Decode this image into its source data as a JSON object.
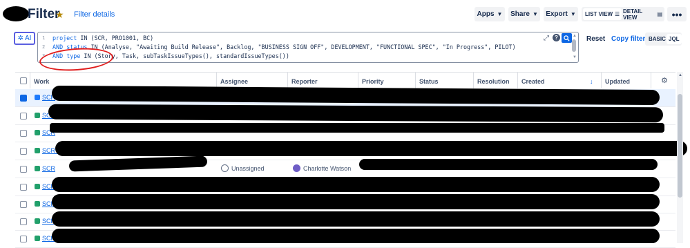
{
  "header": {
    "title": "Filter",
    "details_link": "Filter details",
    "apps_label": "Apps",
    "share_label": "Share",
    "export_label": "Export",
    "list_view_label": "LIST VIEW",
    "detail_view_label": "DETAIL VIEW",
    "more_label": "•••"
  },
  "query": {
    "ai_label": "AI",
    "line_numbers": [
      "1",
      "2",
      "3"
    ],
    "lines": [
      {
        "kw1": "project",
        "rest": " IN (SCR, PRO1001, BC)"
      },
      {
        "kw1": "AND",
        "kw2": "status",
        "rest": " IN (Analyse, \"Awaiting Build Release\", Backlog, \"BUSINESS SIGN OFF\", DEVELOPMENT, \"FUNCTIONAL SPEC\", \"In Progress\", PILOT)"
      },
      {
        "kw1": "AND",
        "kw2": "type",
        "rest": " IN (Story, Task, subTaskIssueTypes(), standardIssueTypes())"
      }
    ],
    "help_label": "?",
    "reset_label": "Reset",
    "copy_filter_label": "Copy filter",
    "basic_label": "BASIC",
    "jql_label": "JQL"
  },
  "table": {
    "columns": [
      "Work",
      "Assignee",
      "Reporter",
      "Priority",
      "Status",
      "Resolution",
      "Created",
      "Updated"
    ],
    "sort_indicator": "↓",
    "rows": [
      {
        "key": "SCR",
        "type": "task",
        "selected": true
      },
      {
        "key": "SCR",
        "type": "story"
      },
      {
        "key": "SCR",
        "type": "story"
      },
      {
        "key": "SCR-",
        "type": "story"
      },
      {
        "key": "SCR",
        "type": "story",
        "assignee": "Unassigned",
        "reporter": "Charlotte Watson"
      },
      {
        "key": "SCR",
        "type": "story"
      },
      {
        "key": "SCR",
        "type": "story"
      },
      {
        "key": "SCR",
        "type": "story"
      },
      {
        "key": "SCR",
        "type": "story"
      }
    ]
  },
  "colors": {
    "accent": "#0c66e4",
    "story": "#22a06b",
    "task": "#1d7afc",
    "annotation": "#e01e1e"
  }
}
